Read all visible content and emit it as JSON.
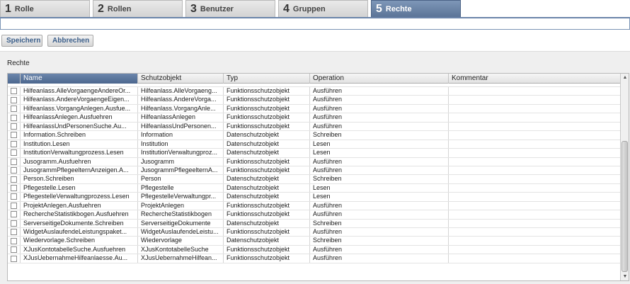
{
  "tabs": [
    {
      "num": "1",
      "label": "Rolle"
    },
    {
      "num": "2",
      "label": "Rollen"
    },
    {
      "num": "3",
      "label": "Benutzer"
    },
    {
      "num": "4",
      "label": "Gruppen"
    },
    {
      "num": "5",
      "label": "Rechte"
    }
  ],
  "active_tab": 4,
  "toolbar": {
    "save_label": "Speichern",
    "cancel_label": "Abbrechen"
  },
  "section_title": "Rechte",
  "columns": [
    "Name",
    "Schutzobjekt",
    "Typ",
    "Operation",
    "Kommentar"
  ],
  "rows": [
    {
      "name": "Hilfeanlass.AlleVorgaengeAndereOr...",
      "schutzobjekt": "Hilfeanlass.AlleVorgaeng...",
      "typ": "Funktionsschutzobjekt",
      "operation": "Ausführen",
      "kommentar": ""
    },
    {
      "name": "Hilfeanlass.AndereVorgaengeEigen...",
      "schutzobjekt": "Hilfeanlass.AndereVorga...",
      "typ": "Funktionsschutzobjekt",
      "operation": "Ausführen",
      "kommentar": ""
    },
    {
      "name": "Hilfeanlass.VorgangAnlegen.Ausfue...",
      "schutzobjekt": "Hilfeanlass.VorgangAnle...",
      "typ": "Funktionsschutzobjekt",
      "operation": "Ausführen",
      "kommentar": ""
    },
    {
      "name": "HilfeanlassAnlegen.Ausfuehren",
      "schutzobjekt": "HilfeanlassAnlegen",
      "typ": "Funktionsschutzobjekt",
      "operation": "Ausführen",
      "kommentar": ""
    },
    {
      "name": "HilfeanlassUndPersonenSuche.Au...",
      "schutzobjekt": "HilfeanlassUndPersonen...",
      "typ": "Funktionsschutzobjekt",
      "operation": "Ausführen",
      "kommentar": ""
    },
    {
      "name": "Information.Schreiben",
      "schutzobjekt": "Information",
      "typ": "Datenschutzobjekt",
      "operation": "Schreiben",
      "kommentar": ""
    },
    {
      "name": "Institution.Lesen",
      "schutzobjekt": "Institution",
      "typ": "Datenschutzobjekt",
      "operation": "Lesen",
      "kommentar": ""
    },
    {
      "name": "InstitutionVerwaltungprozess.Lesen",
      "schutzobjekt": "InstitutionVerwaltungproz...",
      "typ": "Datenschutzobjekt",
      "operation": "Lesen",
      "kommentar": ""
    },
    {
      "name": "Jusogramm.Ausfuehren",
      "schutzobjekt": "Jusogramm",
      "typ": "Funktionsschutzobjekt",
      "operation": "Ausführen",
      "kommentar": ""
    },
    {
      "name": "JusogrammPflegeelternAnzeigen.A...",
      "schutzobjekt": "JusogrammPflegeelternA...",
      "typ": "Funktionsschutzobjekt",
      "operation": "Ausführen",
      "kommentar": ""
    },
    {
      "name": "Person.Schreiben",
      "schutzobjekt": "Person",
      "typ": "Datenschutzobjekt",
      "operation": "Schreiben",
      "kommentar": ""
    },
    {
      "name": "Pflegestelle.Lesen",
      "schutzobjekt": "Pflegestelle",
      "typ": "Datenschutzobjekt",
      "operation": "Lesen",
      "kommentar": ""
    },
    {
      "name": "PflegestelleVerwaltungprozess.Lesen",
      "schutzobjekt": "PflegestelleVerwaltungpr...",
      "typ": "Datenschutzobjekt",
      "operation": "Lesen",
      "kommentar": ""
    },
    {
      "name": "ProjektAnlegen.Ausfuehren",
      "schutzobjekt": "ProjektAnlegen",
      "typ": "Funktionsschutzobjekt",
      "operation": "Ausführen",
      "kommentar": ""
    },
    {
      "name": "RechercheStatistikbogen.Ausfuehren",
      "schutzobjekt": "RechercheStatistikbogen",
      "typ": "Funktionsschutzobjekt",
      "operation": "Ausführen",
      "kommentar": ""
    },
    {
      "name": "ServerseitigeDokumente.Schreiben",
      "schutzobjekt": "ServerseitigeDokumente",
      "typ": "Datenschutzobjekt",
      "operation": "Schreiben",
      "kommentar": ""
    },
    {
      "name": "WidgetAuslaufendeLeistungspaket...",
      "schutzobjekt": "WidgetAuslaufendeLeistu...",
      "typ": "Funktionsschutzobjekt",
      "operation": "Ausführen",
      "kommentar": ""
    },
    {
      "name": "Wiedervorlage.Schreiben",
      "schutzobjekt": "Wiedervorlage",
      "typ": "Datenschutzobjekt",
      "operation": "Schreiben",
      "kommentar": ""
    },
    {
      "name": "XJusKontotabelleSuche.Ausfuehren",
      "schutzobjekt": "XJusKontotabelleSuche",
      "typ": "Funktionsschutzobjekt",
      "operation": "Ausführen",
      "kommentar": ""
    },
    {
      "name": "XJusUebernahmeHilfeanlaesse.Au...",
      "schutzobjekt": "XJusUebernahmeHilfean...",
      "typ": "Funktionsschutzobjekt",
      "operation": "Ausführen",
      "kommentar": ""
    }
  ]
}
